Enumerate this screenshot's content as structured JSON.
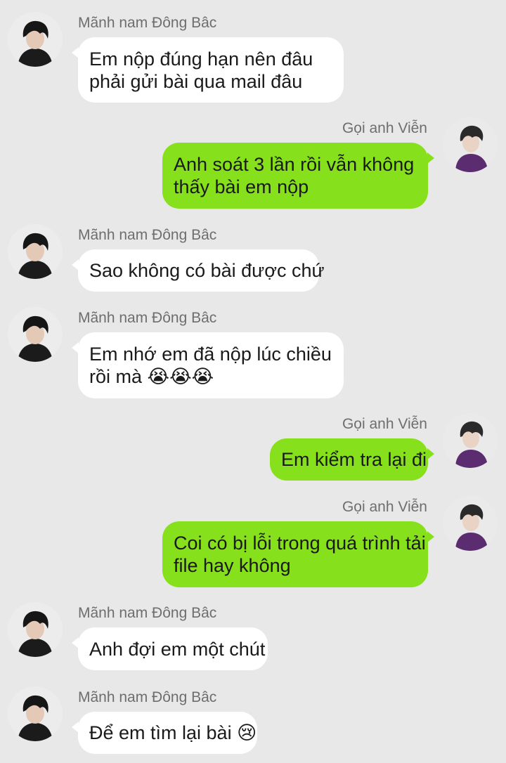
{
  "colors": {
    "background": "#e8e8e8",
    "incoming_bubble": "#ffffff",
    "outgoing_bubble": "#86e01b",
    "sender_name": "#6e6e6e"
  },
  "contacts": {
    "other": {
      "name": "Mãnh nam Đông Bâc",
      "avatar_icon": "avatar-icon"
    },
    "me": {
      "name": "Gọi anh Viễn",
      "avatar_icon": "avatar-icon"
    }
  },
  "messages": [
    {
      "sender": "Mãnh nam Đông Bâc",
      "lines": [
        "Em nộp đúng hạn nên đâu",
        "phải gửi bài qua mail đâu"
      ]
    },
    {
      "sender": "Gọi anh Viễn",
      "lines": [
        "Anh soát 3 lần rồi vẫn không",
        "thấy bài em nộp"
      ]
    },
    {
      "sender": "Mãnh nam Đông Bâc",
      "lines": [
        "Sao không có bài được chứ"
      ]
    },
    {
      "sender": "Mãnh nam Đông Bâc",
      "lines": [
        "Em nhớ em đã nộp lúc chiều",
        "rồi mà 😭😭😭"
      ]
    },
    {
      "sender": "Gọi anh Viễn",
      "lines": [
        "Em kiểm tra lại đi"
      ]
    },
    {
      "sender": "Gọi anh Viễn",
      "lines": [
        "Coi có bị lỗi trong quá trình tải",
        "file hay không"
      ]
    },
    {
      "sender": "Mãnh nam Đông Bâc",
      "lines": [
        "Anh đợi em một chút"
      ]
    },
    {
      "sender": "Mãnh nam Đông Bâc",
      "lines": [
        "Để em tìm lại bài 😢"
      ]
    }
  ]
}
